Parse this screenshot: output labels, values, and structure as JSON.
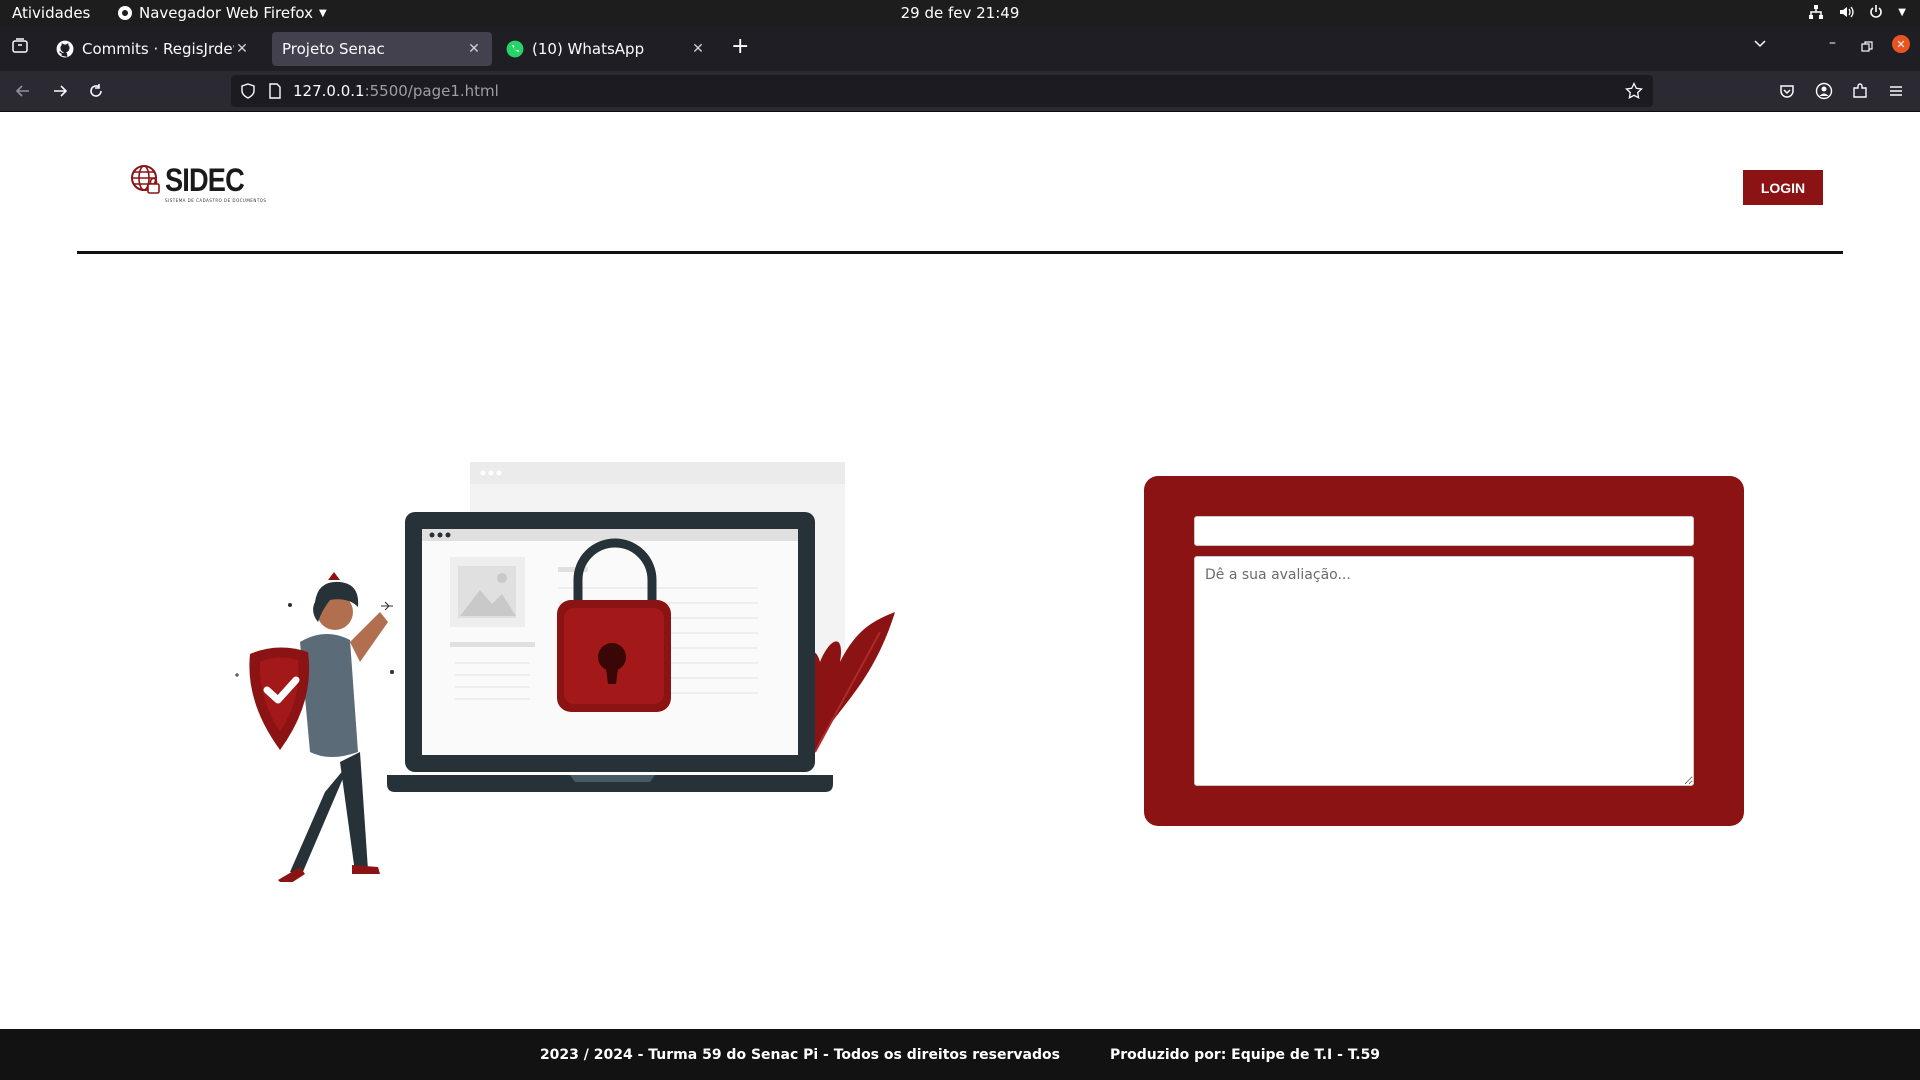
{
  "system_bar": {
    "activities": "Atividades",
    "app_name": "Navegador Web Firefox",
    "clock": "29 de fev  21:49"
  },
  "tabs": [
    {
      "label": "Commits · RegisJrdev/Pr",
      "icon": "github-icon",
      "active": false
    },
    {
      "label": "Projeto Senac",
      "active": true
    },
    {
      "label": "(10) WhatsApp",
      "icon": "whatsapp-icon",
      "active": false
    }
  ],
  "address_bar": {
    "host": "127.0.0.1",
    "rest": ":5500/page1.html"
  },
  "site": {
    "logo_text": "SIDEC",
    "logo_subtitle": "SISTEMA DE CADASTRO DE DOCUMENTOS",
    "login_label": "LOGIN"
  },
  "review_form": {
    "name_value": "",
    "textarea_placeholder": "Dê a sua avaliação..."
  },
  "footer": {
    "left": "2023 / 2024 - Turma 59 do Senac Pi - Todos os direitos reservados",
    "right": "Produzido por: Equipe de T.I - T.59"
  },
  "colors": {
    "brand_red": "#8b1313",
    "dark": "#263238"
  }
}
